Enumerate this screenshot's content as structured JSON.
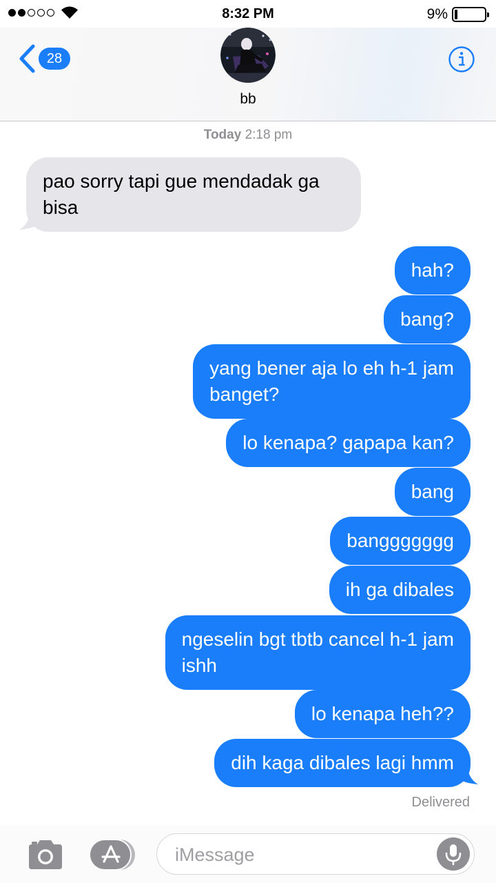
{
  "status_bar": {
    "time": "8:32 PM",
    "battery_percent": "9%",
    "battery_level": 0.09,
    "signal_bars": 2
  },
  "nav": {
    "unread_count": "28",
    "contact_name": "bb",
    "icons": [
      "chevron-left-icon",
      "info-icon"
    ]
  },
  "conversation": {
    "timestamp_day": "Today",
    "timestamp_time": "2:18 pm",
    "received": [
      {
        "lines": [
          "pao sorry tapi gue mendadak ga",
          "bisa"
        ]
      }
    ],
    "sent": [
      {
        "lines": [
          "hah?"
        ]
      },
      {
        "lines": [
          "bang?"
        ]
      },
      {
        "lines": [
          "yang bener aja lo eh h-1 jam",
          "banget?"
        ]
      },
      {
        "lines": [
          "lo kenapa? gapapa kan?"
        ]
      },
      {
        "lines": [
          "bang"
        ]
      },
      {
        "lines": [
          "banggggggg"
        ]
      },
      {
        "lines": [
          "ih ga dibales"
        ]
      },
      {
        "lines": [
          "ngeselin bgt tbtb cancel h-1 jam",
          "ishh"
        ]
      },
      {
        "lines": [
          "lo kenapa heh??"
        ]
      },
      {
        "lines": [
          "dih kaga dibales lagi hmm"
        ]
      }
    ],
    "delivery_status": "Delivered"
  },
  "input_bar": {
    "placeholder": "iMessage",
    "icons": [
      "camera-icon",
      "app-store-icon",
      "microphone-icon"
    ]
  },
  "colors": {
    "accent": "#1a7efb",
    "incoming_bubble": "#e5e5ea",
    "secondary_text": "#8e8e93"
  }
}
